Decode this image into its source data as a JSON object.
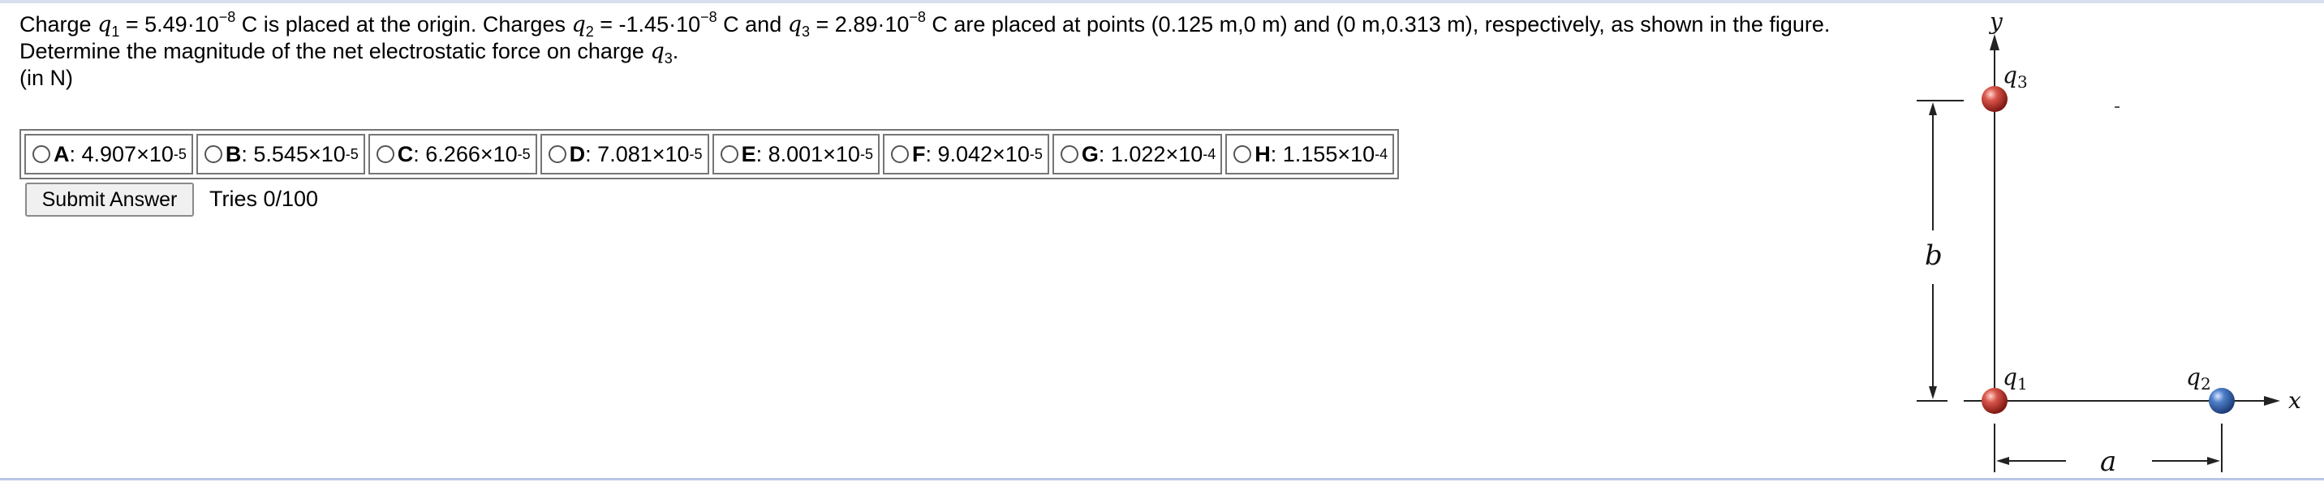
{
  "question": {
    "t1": "Charge ",
    "q1_sym": "q",
    "q1_sub": "1",
    "t2": " = 5.49·10",
    "q1_exp": "−8",
    "t3": " C is placed at the origin. Charges ",
    "q2_sym": "q",
    "q2_sub": "2",
    "t4": " = -1.45·10",
    "q2_exp": "−8",
    "t5": " C and ",
    "q3_sym": "q",
    "q3_sub": "3",
    "t6": " = 2.89·10",
    "q3_exp": "−8",
    "t7": " C are placed at points (0.125 m,0 m) and (0 m,0.313 m), respectively, as shown in the figure. Determine the magnitude of the net electrostatic force on charge ",
    "target_sym": "q",
    "target_sub": "3",
    "t8": ".",
    "units": "(in N)"
  },
  "choices": [
    {
      "letter": "A",
      "mantissa": ": 4.907×10",
      "exponent": "-5"
    },
    {
      "letter": "B",
      "mantissa": ": 5.545×10",
      "exponent": "-5"
    },
    {
      "letter": "C",
      "mantissa": ": 6.266×10",
      "exponent": "-5"
    },
    {
      "letter": "D",
      "mantissa": ": 7.081×10",
      "exponent": "-5"
    },
    {
      "letter": "E",
      "mantissa": ": 8.001×10",
      "exponent": "-5"
    },
    {
      "letter": "F",
      "mantissa": ": 9.042×10",
      "exponent": "-5"
    },
    {
      "letter": "G",
      "mantissa": ": 1.022×10",
      "exponent": "-4"
    },
    {
      "letter": "H",
      "mantissa": ": 1.155×10",
      "exponent": "-4"
    }
  ],
  "submit": {
    "label": "Submit Answer"
  },
  "tries": "Tries 0/100",
  "figure": {
    "y_axis_label": "y",
    "x_axis_label": "x",
    "q3_label": "q",
    "q3_sub": "3",
    "q1_label": "q",
    "q1_sub": "1",
    "q2_label": "q",
    "q2_sub": "2",
    "b_label": "b",
    "a_label": "a",
    "colors": {
      "positive_charge": "#cc3b30",
      "negative_charge": "#3a67b8"
    }
  }
}
